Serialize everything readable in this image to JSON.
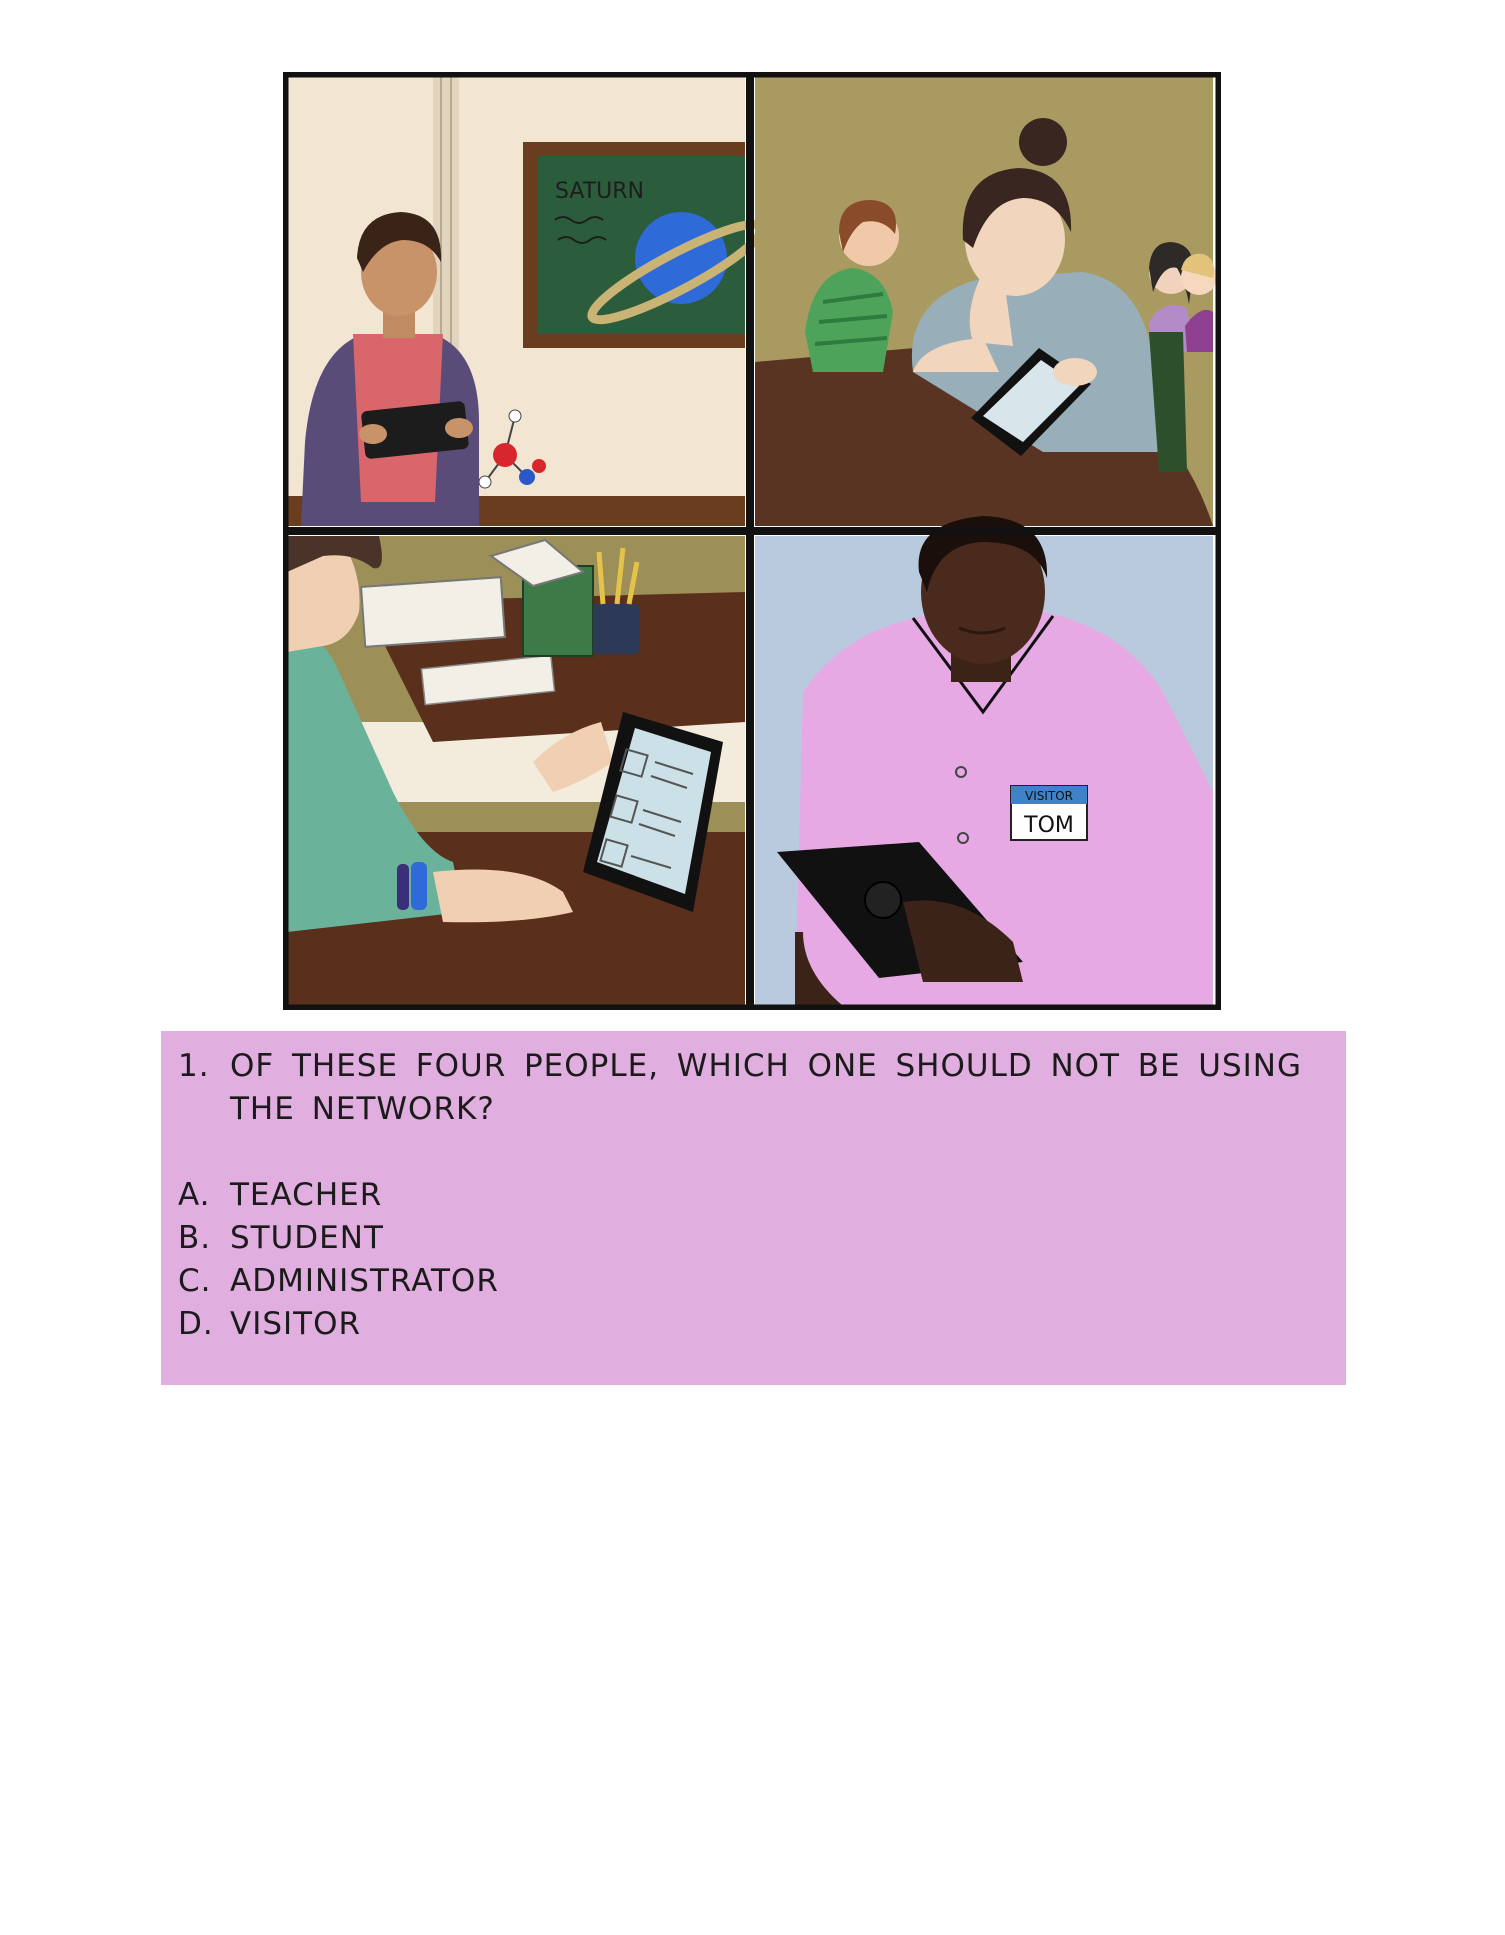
{
  "comic": {
    "chalkboard_label": "SATURN",
    "badge_title": "VISITOR",
    "badge_name": "TOM"
  },
  "question": {
    "number": "1.",
    "text": "OF THESE FOUR PEOPLE, WHICH ONE SHOULD NOT BE USING THE NETWORK?"
  },
  "answers": [
    {
      "letter": "A.",
      "label": "TEACHER"
    },
    {
      "letter": "B.",
      "label": "STUDENT"
    },
    {
      "letter": "C.",
      "label": "ADMINISTRATOR"
    },
    {
      "letter": "D.",
      "label": "VISITOR"
    }
  ],
  "colors": {
    "quiz_background": "#e1aee0",
    "panel_border": "#111111"
  }
}
